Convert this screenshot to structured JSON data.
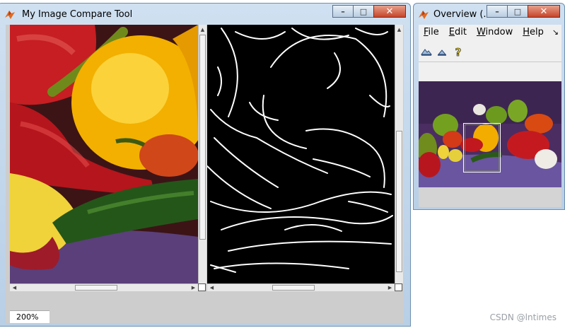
{
  "main_window": {
    "title": "My Image Compare Tool",
    "zoom_level": "200%"
  },
  "overview_window": {
    "title": "Overview (...",
    "menu": [
      "File",
      "Edit",
      "Window",
      "Help"
    ],
    "menu_more": "↘",
    "tools": [
      "zoom-in-tool-icon",
      "zoom-out-tool-icon",
      "help-tool-icon"
    ]
  },
  "window_controls": {
    "minimize": "–",
    "maximize": "□",
    "close": "✕"
  },
  "watermark": "CSDN @lntimes",
  "colors": {
    "image_background": "#5a3f7a",
    "edge_background": "#000000",
    "edge_lines": "#ffffff"
  }
}
